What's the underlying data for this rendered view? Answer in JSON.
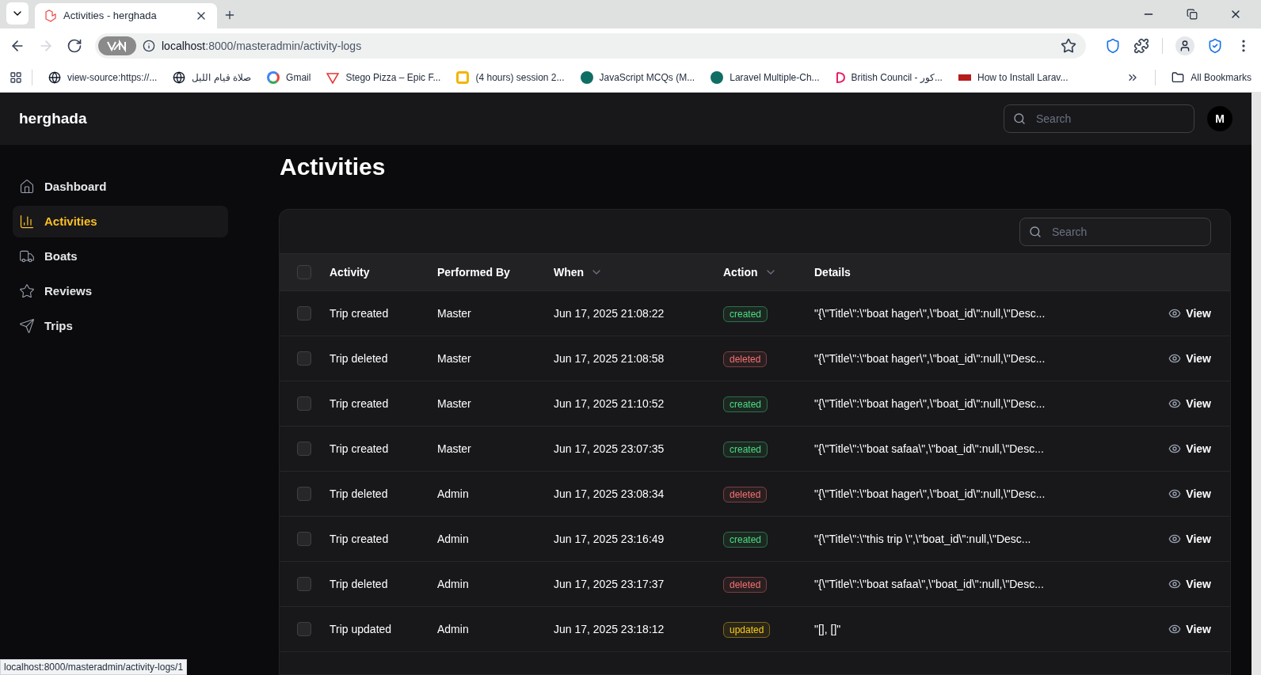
{
  "browser": {
    "tab_title": "Activities - herghada",
    "url_host": "localhost",
    "url_path": ":8000/masteradmin/activity-logs",
    "bookmarks": [
      {
        "label": "view-source:https://...",
        "kind": "globe"
      },
      {
        "label": "صلاة قيام الليل",
        "kind": "globe"
      },
      {
        "label": "Gmail",
        "kind": "google"
      },
      {
        "label": "Stego Pizza – Epic F...",
        "kind": "pizza"
      },
      {
        "label": "(4 hours) session 2...",
        "kind": "slides"
      },
      {
        "label": "JavaScript MCQs (M...",
        "kind": "teal"
      },
      {
        "label": "Laravel Multiple-Ch...",
        "kind": "teal"
      },
      {
        "label": "British Council - كور...",
        "kind": "council"
      },
      {
        "label": "How to Install Larav...",
        "kind": "site"
      }
    ],
    "all_bookmarks": "All Bookmarks"
  },
  "app": {
    "brand": "herghada",
    "search": {
      "placeholder": "Search"
    },
    "avatar": "M"
  },
  "sidebar": {
    "items": [
      {
        "label": "Dashboard",
        "selected": false
      },
      {
        "label": "Activities",
        "selected": true
      },
      {
        "label": "Boats",
        "selected": false
      },
      {
        "label": "Reviews",
        "selected": false
      },
      {
        "label": "Trips",
        "selected": false
      }
    ]
  },
  "page_title": "Activities",
  "table": {
    "search": {
      "placeholder": "Search"
    },
    "select_all": {
      "checked": false
    },
    "columns": [
      {
        "label": "Activity",
        "sortable": false
      },
      {
        "label": "Performed By",
        "sortable": false
      },
      {
        "label": "When",
        "sortable": true
      },
      {
        "label": "Action",
        "sortable": true
      },
      {
        "label": "Details",
        "sortable": false
      }
    ],
    "rows": [
      {
        "checked": false,
        "activity": "Trip created",
        "by": "Master",
        "when": "Jun 17, 2025 21:08:22",
        "action": "created",
        "color": "#4ade80",
        "details": "\"{\\\"Title\\\":\\\"boat hager\\\",\\\"boat_id\\\":null,\\\"Desc...",
        "link": "View"
      },
      {
        "checked": false,
        "activity": "Trip deleted",
        "by": "Master",
        "when": "Jun 17, 2025 21:08:58",
        "action": "deleted",
        "color": "#f87171",
        "details": "\"{\\\"Title\\\":\\\"boat hager\\\",\\\"boat_id\\\":null,\\\"Desc...",
        "link": "View"
      },
      {
        "checked": false,
        "activity": "Trip created",
        "by": "Master",
        "when": "Jun 17, 2025 21:10:52",
        "action": "created",
        "color": "#4ade80",
        "details": "\"{\\\"Title\\\":\\\"boat hager\\\",\\\"boat_id\\\":null,\\\"Desc...",
        "link": "View"
      },
      {
        "checked": false,
        "activity": "Trip created",
        "by": "Master",
        "when": "Jun 17, 2025 23:07:35",
        "action": "created",
        "color": "#4ade80",
        "details": "\"{\\\"Title\\\":\\\"boat safaa\\\",\\\"boat_id\\\":null,\\\"Desc...",
        "link": "View"
      },
      {
        "checked": false,
        "activity": "Trip deleted",
        "by": "Admin",
        "when": "Jun 17, 2025 23:08:34",
        "action": "deleted",
        "color": "#f87171",
        "details": "\"{\\\"Title\\\":\\\"boat hager\\\",\\\"boat_id\\\":null,\\\"Desc...",
        "link": "View"
      },
      {
        "checked": false,
        "activity": "Trip created",
        "by": "Admin",
        "when": "Jun 17, 2025 23:16:49",
        "action": "created",
        "color": "#4ade80",
        "details": "\"{\\\"Title\\\":\\\"this trip \\\",\\\"boat_id\\\":null,\\\"Desc...",
        "link": "View"
      },
      {
        "checked": false,
        "activity": "Trip deleted",
        "by": "Admin",
        "when": "Jun 17, 2025 23:17:37",
        "action": "deleted",
        "color": "#f87171",
        "details": "\"{\\\"Title\\\":\\\"boat safaa\\\",\\\"boat_id\\\":null,\\\"Desc...",
        "link": "View"
      },
      {
        "checked": false,
        "activity": "Trip updated",
        "by": "Admin",
        "when": "Jun 17, 2025 23:18:12",
        "action": "updated",
        "color": "#facc15",
        "details": "\"[], []\"",
        "link": "View"
      }
    ]
  },
  "status_bar": "localhost:8000/masteradmin/activity-logs/1"
}
